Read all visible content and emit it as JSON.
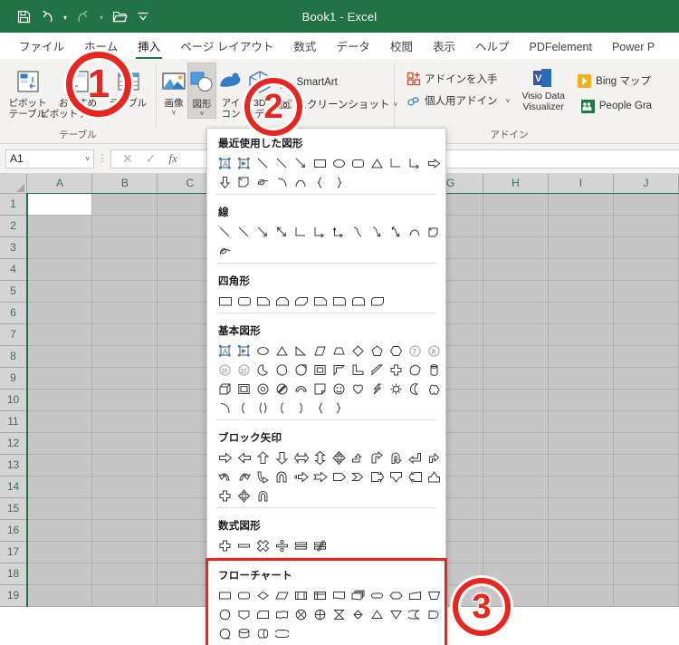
{
  "titlebar": {
    "document_title": "Book1  -  Excel",
    "qat": [
      {
        "name": "save-icon",
        "label": "保存"
      },
      {
        "name": "undo-icon",
        "label": "元に戻す"
      },
      {
        "name": "redo-icon",
        "label": "やり直し"
      },
      {
        "name": "open-icon",
        "label": "開く"
      },
      {
        "name": "customize-qat-icon",
        "label": "クイック アクセス ツール バーのユーザー設定"
      }
    ]
  },
  "tabs": [
    {
      "label": "ファイル",
      "active": false
    },
    {
      "label": "ホーム",
      "active": false
    },
    {
      "label": "挿入",
      "active": true
    },
    {
      "label": "ページ レイアウト",
      "active": false
    },
    {
      "label": "数式",
      "active": false
    },
    {
      "label": "データ",
      "active": false
    },
    {
      "label": "校閲",
      "active": false
    },
    {
      "label": "表示",
      "active": false
    },
    {
      "label": "ヘルプ",
      "active": false
    },
    {
      "label": "PDFelement",
      "active": false
    },
    {
      "label": "Power P",
      "active": false
    }
  ],
  "ribbon": {
    "groups": [
      {
        "name": "table-group",
        "label": "テーブル",
        "buttons": [
          {
            "label1": "ピボット",
            "label2": "テーブル",
            "icon": "pivot-table-icon"
          },
          {
            "label1": "おすすめ",
            "label2": "ピボットテーブル",
            "icon": "recommended-pivot-icon"
          },
          {
            "label1": "テーブル",
            "label2": "",
            "icon": "table-icon"
          }
        ]
      },
      {
        "name": "illustrations-group",
        "label": "",
        "buttons": [
          {
            "label1": "画像",
            "label2": "",
            "icon": "picture-icon",
            "dropdown": "˅"
          },
          {
            "label1": "図形",
            "label2": "",
            "icon": "shapes-icon",
            "dropdown": "˅",
            "pressed": true
          },
          {
            "label1": "アイ",
            "label2": "コン",
            "icon": "icons-icon",
            "dropdown": ""
          },
          {
            "label1": "3D",
            "label2": "モデル",
            "icon": "model3d-icon",
            "dropdown": "˅"
          }
        ],
        "small_buttons": [
          {
            "label": "SmartArt",
            "icon": "smartart-icon"
          },
          {
            "label": "スクリーンショット",
            "icon": "screenshot-icon",
            "dropdown": "˅"
          }
        ]
      },
      {
        "name": "addins-group",
        "label": "アドイン",
        "small_buttons": [
          {
            "label": "アドインを入手",
            "icon": "get-addins-icon"
          },
          {
            "label": "個人用アドイン",
            "icon": "my-addins-icon",
            "dropdown": "˅"
          }
        ],
        "big_buttons": [
          {
            "label1": "Visio Data",
            "label2": "Visualizer",
            "icon": "visio-icon"
          },
          {
            "label1": "Bing マップ",
            "label2": "",
            "icon": "bing-maps-icon"
          },
          {
            "label1": "People Gra",
            "label2": "",
            "icon": "people-graph-icon"
          }
        ]
      }
    ]
  },
  "formula_bar": {
    "name_box_value": "A1",
    "name_box_caret": "˅",
    "cancel_icon": "✕",
    "enter_icon": "✓",
    "function_icon": "fx",
    "formula_value": "",
    "formula_placeholder": ""
  },
  "grid": {
    "columns": [
      "A",
      "B",
      "C",
      "D",
      "E",
      "F",
      "G",
      "H",
      "I",
      "J"
    ],
    "rows": [
      "1",
      "2",
      "3",
      "4",
      "5",
      "6",
      "7",
      "8",
      "9",
      "10",
      "11",
      "12",
      "13",
      "14",
      "15",
      "16",
      "17",
      "18",
      "19"
    ],
    "active_cell": "A1"
  },
  "shapes_menu": {
    "sections": [
      {
        "name": "recently-used-shapes",
        "title": "最近使用した図形",
        "shapes": [
          "textbox",
          "textbox-arrow",
          "line",
          "line",
          "line-arrow",
          "rectangle",
          "ellipse",
          "rounded-rectangle",
          "triangle",
          "elbow-connector",
          "elbow-connector-arrow",
          "right-arrow",
          "down-arrow",
          "flowchart-data",
          "scribble",
          "arc",
          "curve",
          "left-brace",
          "right-brace"
        ]
      },
      {
        "name": "lines",
        "title": "線",
        "shapes": [
          "line",
          "line",
          "line-arrow",
          "line-double-arrow",
          "elbow-connector",
          "elbow-arrow-connector",
          "elbow-double-arrow",
          "curved-connector",
          "curved-arrow-connector",
          "curved-double-arrow",
          "arc",
          "freeform",
          "scribble"
        ]
      },
      {
        "name": "rectangles",
        "title": "四角形",
        "shapes": [
          "rectangle",
          "rounded-rectangle",
          "snip-single-corner",
          "snip-same-side-corner",
          "snip-diagonal-corner",
          "snip-round-corner",
          "round-single-corner",
          "round-same-side-corner",
          "round-diagonal-corner"
        ]
      },
      {
        "name": "basic-shapes",
        "title": "基本図形",
        "shapes": [
          "textbox",
          "textbox-arrow",
          "oval",
          "isosceles-triangle",
          "right-triangle",
          "parallelogram",
          "trapezoid",
          "diamond",
          "pentagon",
          "hexagon",
          "heptagon",
          "octagon",
          "decagon",
          "dodecagon",
          "pie",
          "chord",
          "teardrop",
          "frame",
          "half-frame",
          "L-shape",
          "diagonal-stripe",
          "cross",
          "regular-pentagon-burst",
          "cylinder",
          "cube",
          "bevel",
          "donut",
          "no-symbol",
          "block-arc",
          "folded-corner",
          "smiley-face",
          "heart",
          "lightning-bolt",
          "sun",
          "moon",
          "cloud",
          "arc",
          "left-bracket",
          "left-brace",
          "right-bracket",
          "right-bracket2",
          "left-brace2",
          "right-brace2"
        ]
      },
      {
        "name": "block-arrows",
        "title": "ブロック矢印",
        "shapes": [
          "right-arrow",
          "left-arrow",
          "up-arrow",
          "down-arrow",
          "left-right-arrow",
          "up-down-arrow",
          "quad-arrow",
          "bent-up-arrow",
          "bent-arrow",
          "u-turn-arrow",
          "left-up-arrow",
          "bent-arrow-2",
          "curved-right-arrow",
          "curved-left-arrow",
          "curved-up-arrow",
          "curved-down-arrow",
          "striped-right-arrow",
          "notched-right-arrow",
          "pentagon-arrow",
          "chevron",
          "right-arrow-callout",
          "down-arrow-callout",
          "left-arrow-callout",
          "up-arrow-callout",
          "cross-arrow",
          "quad-arrow-callout",
          "circular-arrow"
        ]
      },
      {
        "name": "equation-shapes",
        "title": "数式図形",
        "shapes": [
          "plus",
          "minus",
          "multiply",
          "divide",
          "equal",
          "not-equal"
        ]
      },
      {
        "name": "flowchart",
        "title": "フローチャート",
        "highlighted": true,
        "shapes": [
          "fc-process",
          "fc-alternate-process",
          "fc-decision",
          "fc-data",
          "fc-predefined-process",
          "fc-internal-storage",
          "fc-document",
          "fc-multidocument",
          "fc-terminator",
          "fc-preparation",
          "fc-manual-input",
          "fc-manual-operation",
          "fc-connector",
          "fc-off-page-connector",
          "fc-card",
          "fc-punched-tape",
          "fc-summing-junction",
          "fc-or",
          "fc-collate",
          "fc-sort",
          "fc-extract",
          "fc-merge",
          "fc-stored-data",
          "fc-delay",
          "fc-sequential-access",
          "fc-magnetic-disk",
          "fc-direct-access",
          "fc-display"
        ]
      }
    ]
  },
  "callouts": [
    {
      "name": "callout-1",
      "number": "①",
      "text": "1"
    },
    {
      "name": "callout-2",
      "number": "②",
      "text": "2"
    },
    {
      "name": "callout-3",
      "number": "③",
      "text": "3"
    }
  ],
  "colors": {
    "excel_green": "#217346",
    "callout_red": "#e8261d",
    "ribbon_bg": "#f3f2f1",
    "grid_gray": "#c6c6c6"
  }
}
